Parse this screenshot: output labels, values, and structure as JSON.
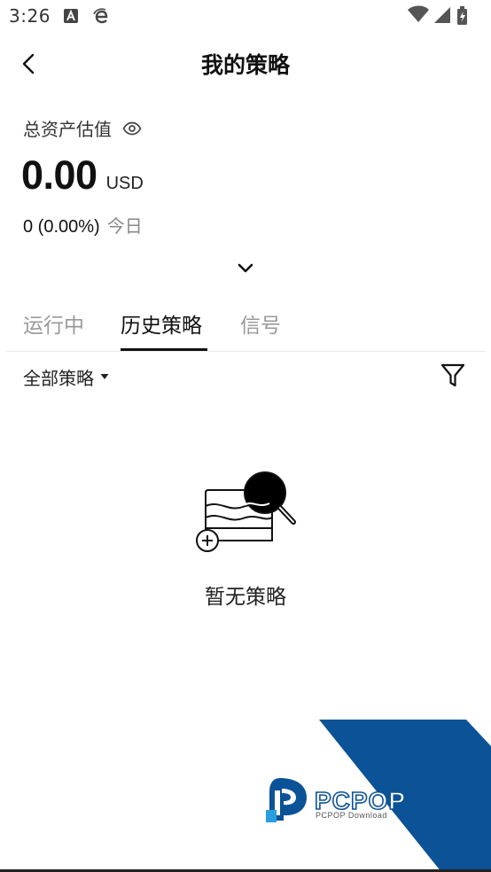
{
  "status_bar": {
    "time": "3:26",
    "icons": [
      "a-notification-icon",
      "edge-browser-icon",
      "wifi-icon",
      "signal-icon",
      "battery-charging-icon"
    ]
  },
  "header": {
    "title": "我的策略",
    "back_icon": "chevron-left-icon"
  },
  "assets": {
    "label": "总资产估值",
    "visibility_icon": "eye-icon",
    "value": "0.00",
    "currency": "USD",
    "pnl": "0 (0.00%)",
    "pnl_period": "今日",
    "expand_icon": "chevron-down-icon"
  },
  "tabs": [
    {
      "label": "运行中",
      "active": false
    },
    {
      "label": "历史策略",
      "active": true
    },
    {
      "label": "信号",
      "active": false
    }
  ],
  "filter": {
    "selected": "全部策略",
    "caret_icon": "caret-down-icon",
    "filter_icon": "funnel-icon"
  },
  "empty_state": {
    "illustration_icon": "empty-search-illustration",
    "message": "暂无策略"
  },
  "watermark": {
    "title": "PCPOP下载",
    "subtitle": "PCPOP Download",
    "colors": {
      "band": "#0c5297",
      "text": "#ffffff"
    }
  },
  "colors": {
    "text_primary": "#111111",
    "text_secondary": "#888888",
    "tab_inactive": "#999999",
    "background": "#ffffff"
  }
}
